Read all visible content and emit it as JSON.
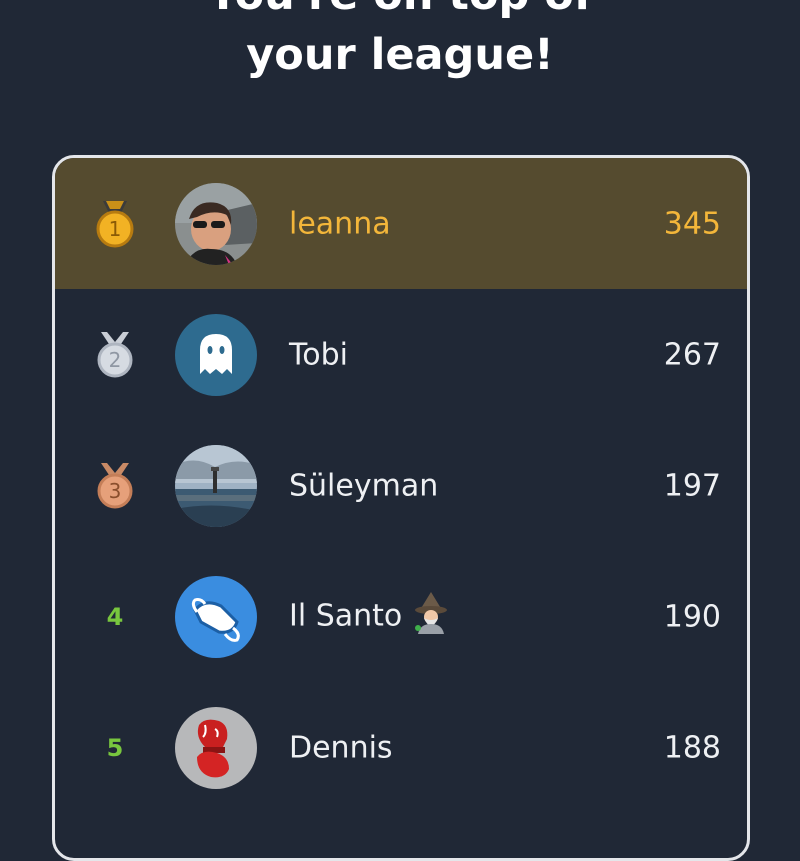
{
  "headline": {
    "line1": "You're on top of",
    "line2": "your league!"
  },
  "leaderboard": {
    "rows": [
      {
        "rank": "1",
        "name": "leanna",
        "score": "345",
        "highlight": true,
        "medal": "gold-medal-icon",
        "avatar": "user-photo-avatar"
      },
      {
        "rank": "2",
        "name": "Tobi",
        "score": "267",
        "medal": "silver-medal-icon",
        "avatar": "ghost-avatar"
      },
      {
        "rank": "3",
        "name": "Süleyman",
        "score": "197",
        "medal": "bronze-medal-icon",
        "avatar": "harbor-lighthouse-photo-avatar"
      },
      {
        "rank": "4",
        "name": "Il Santo",
        "score": "190",
        "emoji": "mage-emoji-icon",
        "avatar": "face-mask-avatar"
      },
      {
        "rank": "5",
        "name": "Dennis",
        "score": "188",
        "avatar": "boxing-gloves-avatar"
      }
    ]
  },
  "colors": {
    "background": "#202836",
    "highlight_row": "#554b2f",
    "highlight_text": "#f3b63a",
    "rank_green": "#78c63e",
    "border": "#e4e6ea"
  }
}
